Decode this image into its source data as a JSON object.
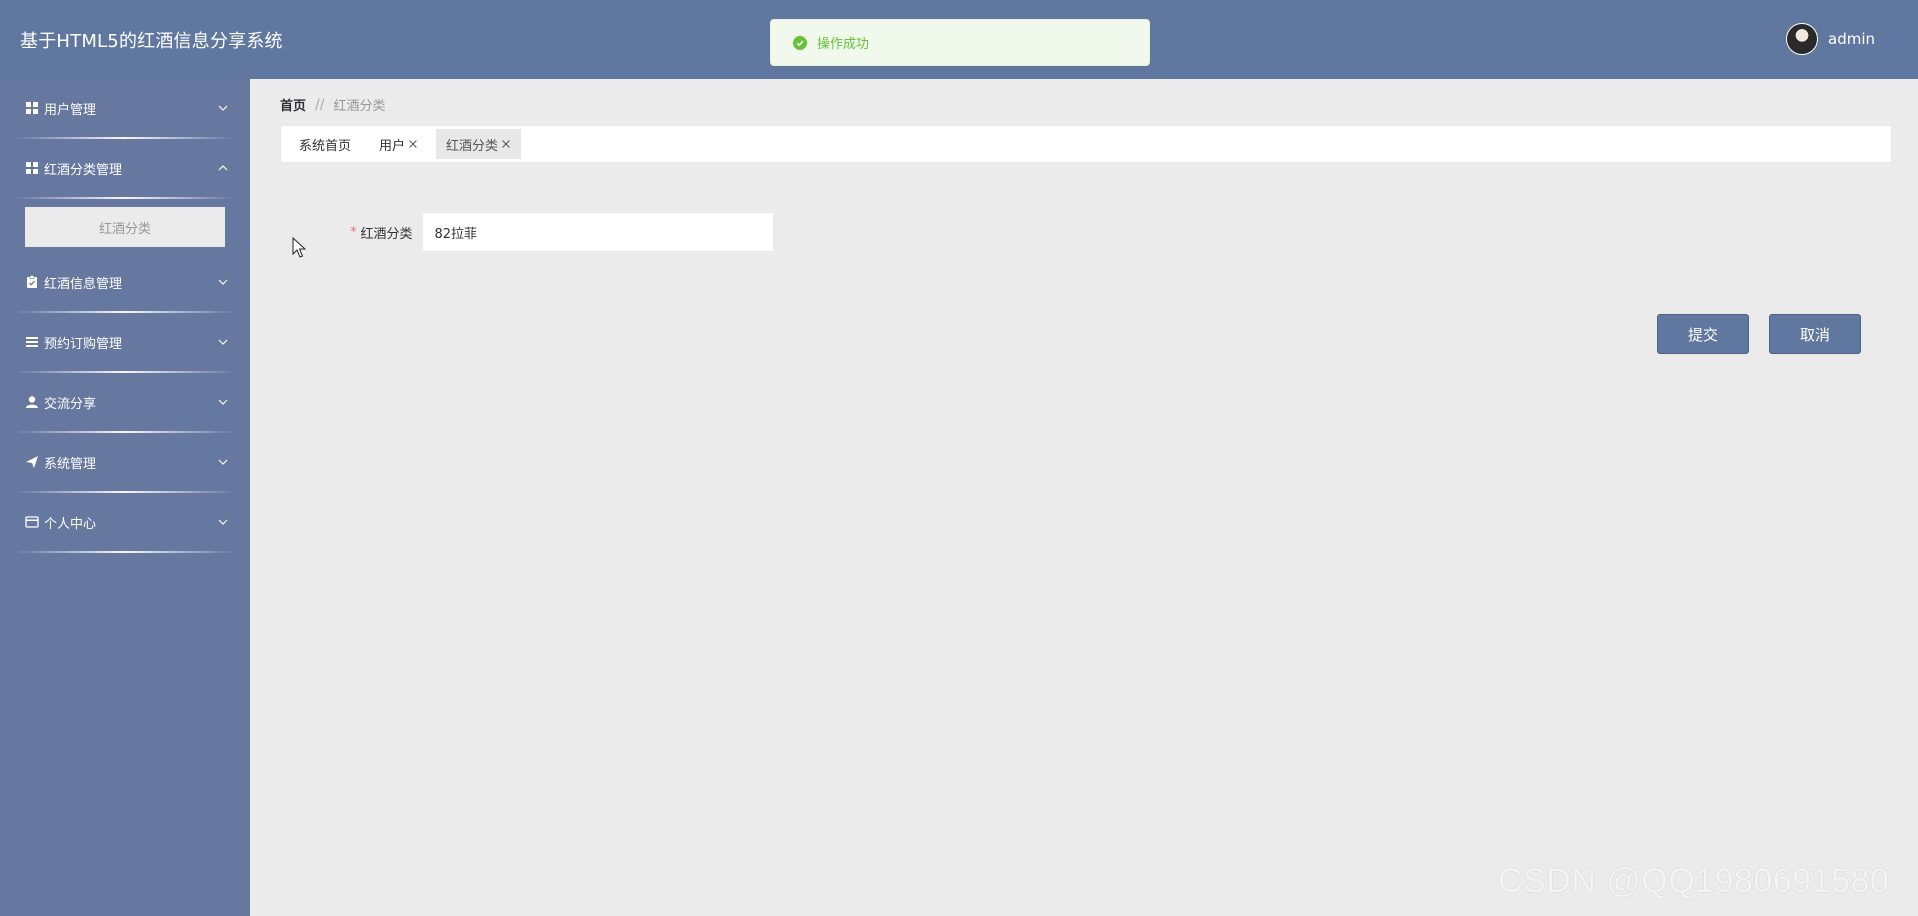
{
  "header": {
    "app_title": "基于HTML5的红酒信息分享系统",
    "toast_message": "操作成功",
    "username": "admin"
  },
  "sidebar": {
    "items": [
      {
        "label": "用户管理",
        "icon": "grid-icon",
        "expanded": false
      },
      {
        "label": "红酒分类管理",
        "icon": "grid-icon",
        "expanded": true,
        "children": [
          {
            "label": "红酒分类"
          }
        ]
      },
      {
        "label": "红酒信息管理",
        "icon": "clipboard-icon",
        "expanded": false
      },
      {
        "label": "预约订购管理",
        "icon": "list-icon",
        "expanded": false
      },
      {
        "label": "交流分享",
        "icon": "user-icon",
        "expanded": false
      },
      {
        "label": "系统管理",
        "icon": "send-icon",
        "expanded": false
      },
      {
        "label": "个人中心",
        "icon": "card-icon",
        "expanded": false
      }
    ]
  },
  "breadcrumb": {
    "home": "首页",
    "separator": "//",
    "current": "红酒分类"
  },
  "tabs": [
    {
      "label": "系统首页",
      "closable": false,
      "active": false
    },
    {
      "label": "用户",
      "closable": true,
      "active": false
    },
    {
      "label": "红酒分类",
      "closable": true,
      "active": true
    }
  ],
  "form": {
    "required_mark": "*",
    "category_label": "红酒分类",
    "category_value": "82拉菲"
  },
  "buttons": {
    "submit": "提交",
    "cancel": "取消"
  },
  "watermark": "CSDN @QQ1980691580",
  "colors": {
    "header_bg": "#60779f",
    "sidebar_bg": "#6677a0",
    "toast_success": "#67c23a",
    "content_bg": "#ebebeb"
  }
}
